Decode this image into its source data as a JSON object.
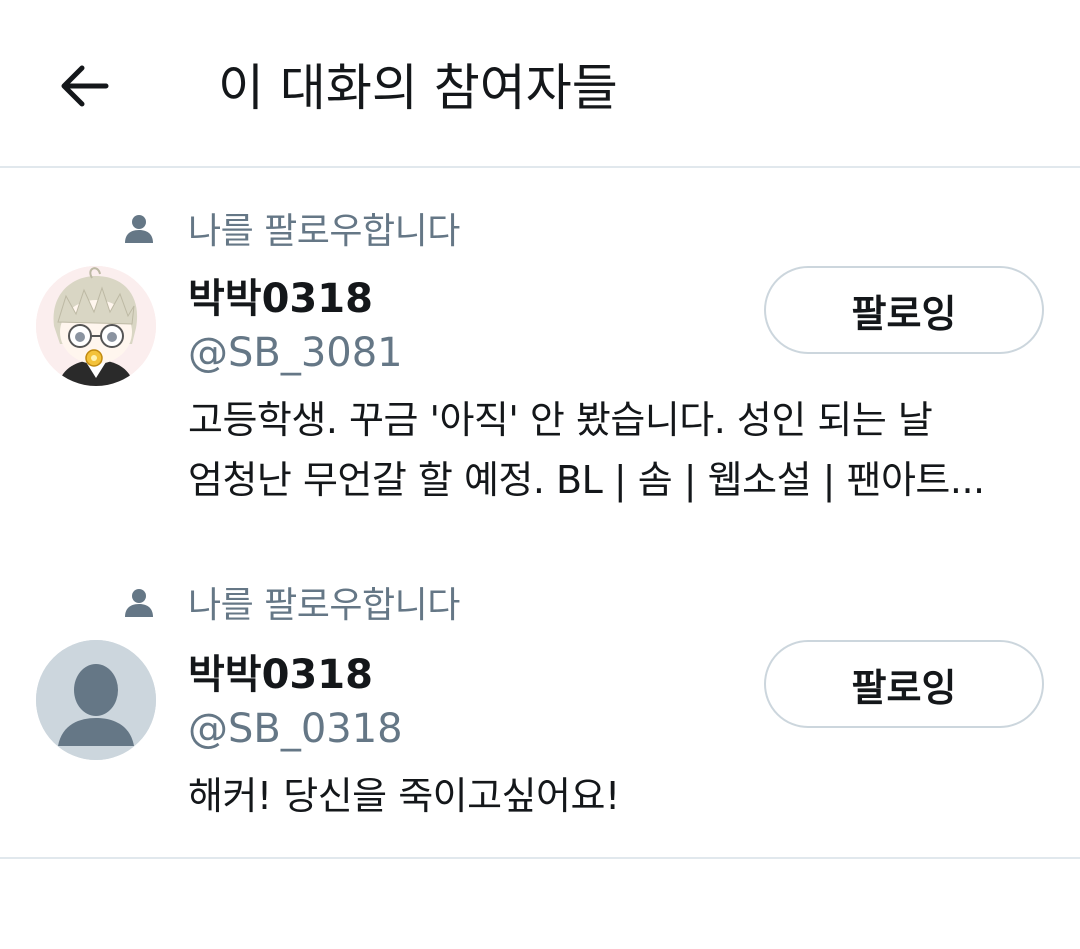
{
  "header": {
    "title": "이 대화의 참여자들",
    "back_icon": "arrow-left-icon"
  },
  "users": [
    {
      "follows_you": "나를 팔로우합니다",
      "display_name": "박박0318",
      "handle": "@SB_3081",
      "bio_line1": "고등학생. 꾸금 '아직' 안 봤습니다. 성인 되는 날",
      "bio_line2": "엄청난 무언갈 할 예정.  BL | 솜 | 웹소설 | 팬아트...",
      "follow_button": "팔로잉",
      "avatar": "anime-character-avatar"
    },
    {
      "follows_you": "나를 팔로우합니다",
      "display_name": "박박0318",
      "handle": "@SB_0318",
      "bio_line1": "해커! 당신을 죽이고싶어요!",
      "follow_button": "팔로잉",
      "avatar": "default-avatar"
    }
  ],
  "colors": {
    "text_primary": "#14171a",
    "text_secondary": "#657786",
    "border": "#ccd6dd",
    "divider": "#e1e8ed",
    "default_avatar_bg": "#ccd6dd",
    "default_avatar_fg": "#657786"
  }
}
